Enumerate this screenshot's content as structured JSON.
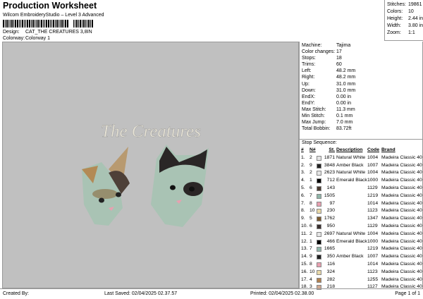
{
  "header": {
    "title": "Production Worksheet",
    "subtitle": "Wilcom EmbroideryStudio – Level 3 Advanced",
    "design_label": "Design:",
    "design_value": "CAT_THE CREATURES 3,8IN",
    "colorway_label": "Colorway:",
    "colorway_value": "Colorway 1"
  },
  "stats": [
    {
      "k": "Stitches:",
      "v": "19861"
    },
    {
      "k": "Colors:",
      "v": "10"
    },
    {
      "k": "Height:",
      "v": "2.44 in"
    },
    {
      "k": "Width:",
      "v": "3.80 in"
    },
    {
      "k": "Zoom:",
      "v": "1:1"
    }
  ],
  "preview": {
    "caption": "The Creatures"
  },
  "specs": [
    {
      "k": "Machine:",
      "v": "Tajima"
    },
    {
      "k": "Color changes:",
      "v": "17"
    },
    {
      "k": "Stops:",
      "v": "18"
    },
    {
      "k": "Trims:",
      "v": "60"
    },
    {
      "k": "Left:",
      "v": "48.2 mm"
    },
    {
      "k": "Right:",
      "v": "48.2 mm"
    },
    {
      "k": "Up:",
      "v": "31.0 mm"
    },
    {
      "k": "Down:",
      "v": "31.0 mm"
    },
    {
      "k": "EndX:",
      "v": "0.00 in"
    },
    {
      "k": "EndY:",
      "v": "0.00 in"
    },
    {
      "k": "Max Stitch:",
      "v": "11.3 mm"
    },
    {
      "k": "Min Stitch:",
      "v": "0.1 mm"
    },
    {
      "k": "Max Jump:",
      "v": "7.0 mm"
    },
    {
      "k": "Total Bobbin:",
      "v": "83.72ft"
    }
  ],
  "sequence": {
    "title": "Stop Sequence:",
    "headers": [
      "#",
      "N#",
      "St.",
      "Description",
      "Code",
      "Brand"
    ],
    "rows": [
      [
        "1.",
        "2",
        "#e4e4e4",
        "1871",
        "Natural White",
        "1004",
        "Madeira Classic 40"
      ],
      [
        "2.",
        "9",
        "#222222",
        "3848",
        "Amber Black",
        "1007",
        "Madeira Classic 40"
      ],
      [
        "3.",
        "2",
        "#e4e4e4",
        "2623",
        "Natural White",
        "1004",
        "Madeira Classic 40"
      ],
      [
        "4.",
        "1",
        "#000000",
        "712",
        "Emerald Black",
        "1000",
        "Madeira Classic 40"
      ],
      [
        "5.",
        "6",
        "#4a3a30",
        "143",
        "",
        "1129",
        "Madeira Classic 40"
      ],
      [
        "6.",
        "7",
        "#8fb5a8",
        "1505",
        "",
        "1219",
        "Madeira Classic 40"
      ],
      [
        "7.",
        "8",
        "#e8a0b0",
        "97",
        "",
        "1014",
        "Madeira Classic 40"
      ],
      [
        "8.",
        "10",
        "#e8d8a8",
        "230",
        "",
        "1123",
        "Madeira Classic 40"
      ],
      [
        "9.",
        "5",
        "#7a5a30",
        "1762",
        "",
        "1347",
        "Madeira Classic 40"
      ],
      [
        "10.",
        "6",
        "#3a3030",
        "950",
        "",
        "1129",
        "Madeira Classic 40"
      ],
      [
        "11.",
        "2",
        "#e4e4e4",
        "2697",
        "Natural White",
        "1004",
        "Madeira Classic 40"
      ],
      [
        "12.",
        "1",
        "#000000",
        "466",
        "Emerald Black",
        "1000",
        "Madeira Classic 40"
      ],
      [
        "13.",
        "7",
        "#8fb5a8",
        "1665",
        "",
        "1219",
        "Madeira Classic 40"
      ],
      [
        "14.",
        "9",
        "#222222",
        "350",
        "Amber Black",
        "1007",
        "Madeira Classic 40"
      ],
      [
        "15.",
        "8",
        "#e8a0b0",
        "116",
        "",
        "1014",
        "Madeira Classic 40"
      ],
      [
        "16.",
        "10",
        "#e8d8a8",
        "324",
        "",
        "1123",
        "Madeira Classic 40"
      ],
      [
        "17.",
        "4",
        "#b08050",
        "282",
        "",
        "1255",
        "Madeira Classic 40"
      ],
      [
        "18.",
        "3",
        "#d0a890",
        "218",
        "",
        "1127",
        "Madeira Classic 40"
      ]
    ]
  },
  "footer": {
    "created": "Created By:",
    "saved": "Last Saved: 02/04/2025 02.37.57",
    "printed": "Printed: 02/04/2025 02.38.00",
    "page": "Page 1 of 1"
  }
}
